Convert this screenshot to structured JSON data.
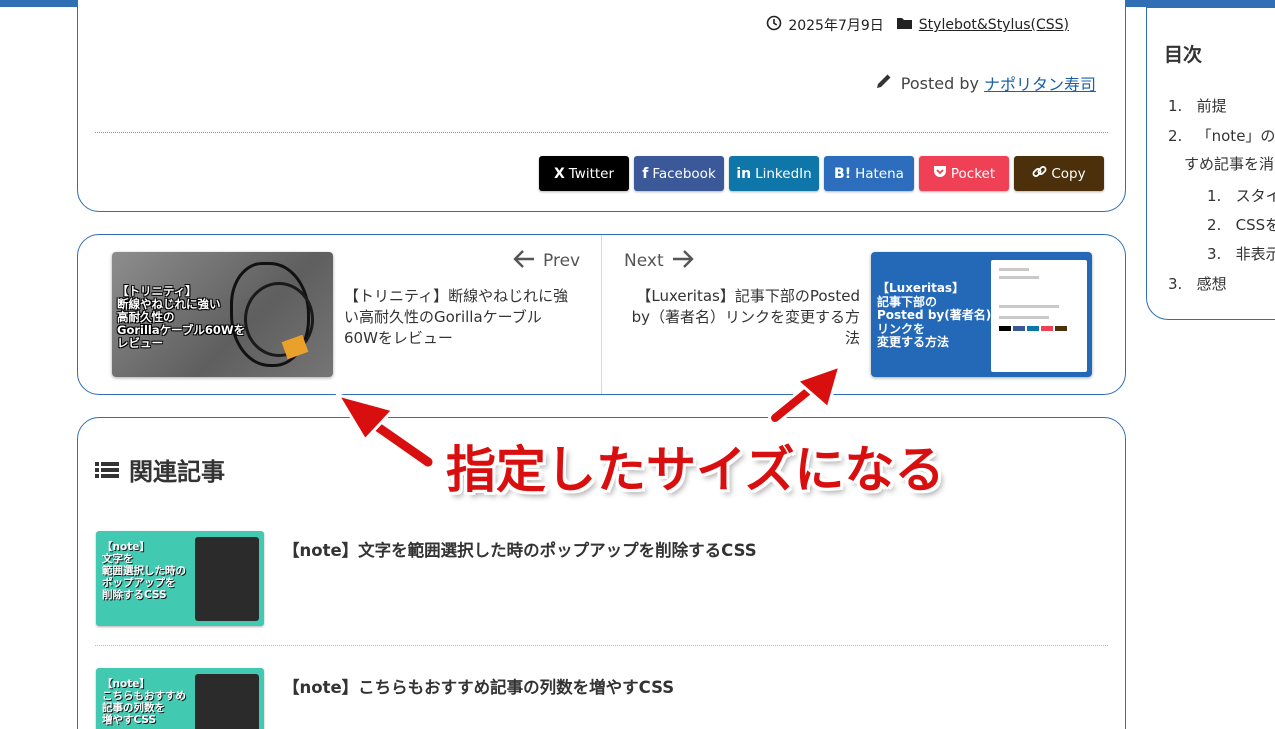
{
  "post_meta": {
    "date": "2025年7月9日",
    "category": "Stylebot&Stylus(CSS)",
    "posted_by_prefix": "Posted by",
    "author": "ナポリタン寿司"
  },
  "share_buttons": [
    {
      "label": "Twitter",
      "icon": "X",
      "color": "#000000"
    },
    {
      "label": "Facebook",
      "icon": "f",
      "color": "#3b5998"
    },
    {
      "label": "LinkedIn",
      "icon": "in",
      "color": "#0e76a8"
    },
    {
      "label": "Hatena",
      "icon": "B!",
      "color": "#2c6ebd"
    },
    {
      "label": "Pocket",
      "icon": "pocket-icon",
      "color": "#ef4056"
    },
    {
      "label": "Copy",
      "icon": "link-icon",
      "color": "#4b300b"
    }
  ],
  "pager": {
    "prev_label": "Prev",
    "next_label": "Next",
    "prev_title": "【トリニティ】断線やねじれに強い高耐久性のGorillaケーブル60Wをレビュー",
    "next_title": "【Luxeritas】記事下部のPosted by（著者名）リンクを変更する方法",
    "prev_thumb_text": "【トリニティ】\n断線やねじれに強い\n高耐久性の\nGorillaケーブル60Wを\nレビュー",
    "next_thumb_text": "【Luxeritas】\n記事下部の\nPosted by(著者名)\nリンクを\n変更する方法"
  },
  "related": {
    "heading": "関連記事",
    "items": [
      {
        "title": "【note】文字を範囲選択した時のポップアップを削除するCSS",
        "thumb_text": "【note】\n文字を\n範囲選択した時の\nポップアップを\n削除するCSS"
      },
      {
        "title": "【note】こちらもおすすめ記事の列数を増やすCSS",
        "thumb_text": "【note】\nこちらもおすすめ\n記事の列数を\n増やすCSS"
      }
    ]
  },
  "toc": {
    "title": "目次",
    "items": [
      {
        "num": "1.",
        "label": "前提"
      },
      {
        "num": "2.",
        "label": "「note」の"
      },
      {
        "num": "",
        "label": "すめ記事を消"
      },
      {
        "num": "1.",
        "label": "スタイ"
      },
      {
        "num": "2.",
        "label": "CSSを"
      },
      {
        "num": "3.",
        "label": "非表示"
      },
      {
        "num": "3.",
        "label": "感想"
      }
    ]
  },
  "annotation": {
    "text": "指定したサイズになる",
    "color": "#d90f0f"
  },
  "colors": {
    "accent_border": "#2f6fb6",
    "link": "#1a5fa8"
  }
}
